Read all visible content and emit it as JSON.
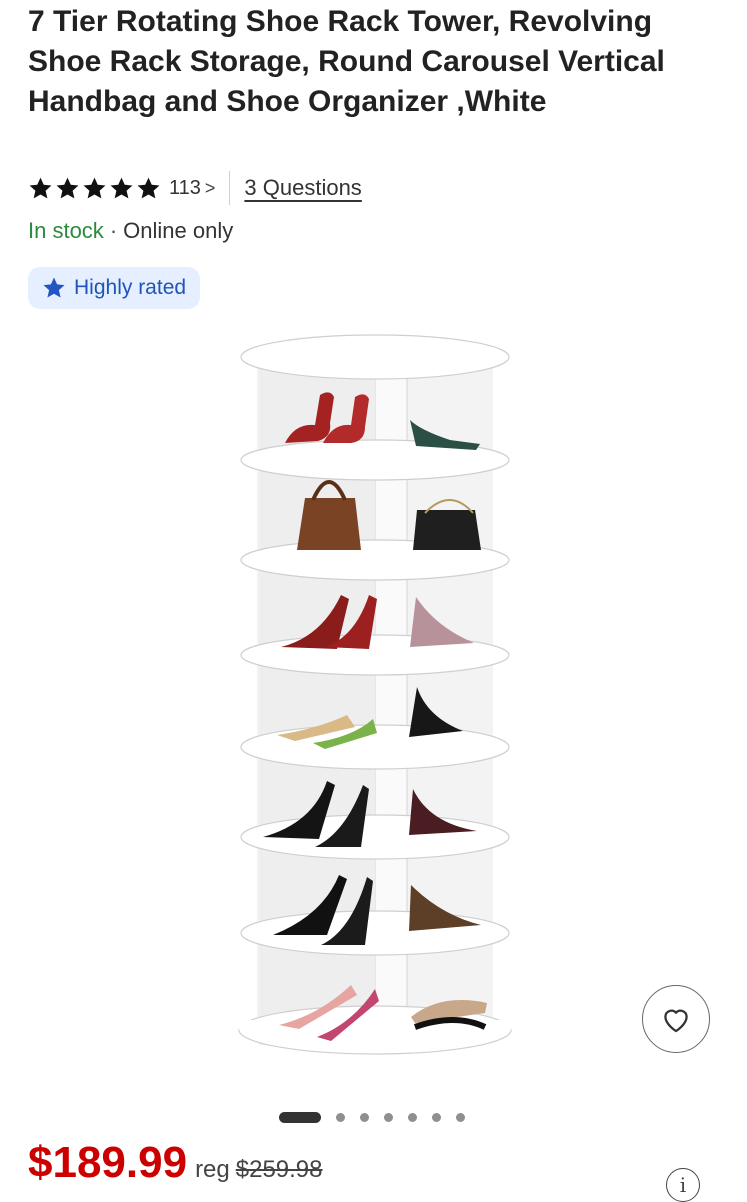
{
  "product": {
    "title": "7 Tier Rotating Shoe Rack Tower, Revolving Shoe Rack Storage, Round Carousel Vertical Handbag and Shoe Organizer ,White",
    "image_alt": "White 7 tier rotating shoe rack tower holding shoes and handbags"
  },
  "rating": {
    "stars": 5,
    "count": "113",
    "questions_link": "3 Questions"
  },
  "availability": {
    "status": "In stock",
    "separator": "·",
    "channel": "Online only",
    "status_color": "#2b8a3e"
  },
  "badge": {
    "label": "Highly rated",
    "icon": "star-icon",
    "color": "#1f54b8",
    "background": "#e6efff"
  },
  "carousel": {
    "total_slides": 7,
    "active_index": 0
  },
  "price": {
    "current": "$189.99",
    "reg_label": "reg",
    "regular": "$259.98",
    "color": "#cc0000"
  },
  "icons": {
    "favorite": "heart-icon",
    "info": "info-icon",
    "info_glyph": "i"
  }
}
